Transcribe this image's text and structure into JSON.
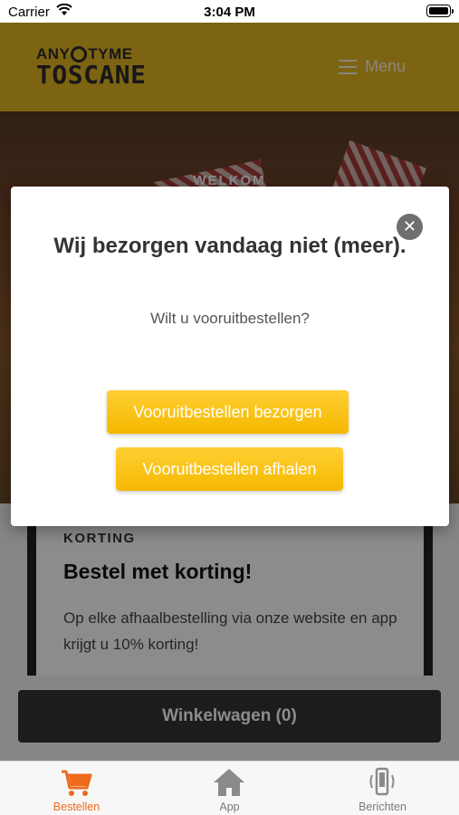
{
  "status_bar": {
    "carrier": "Carrier",
    "time": "3:04 PM"
  },
  "header": {
    "logo_line1_left": "ANY",
    "logo_line1_right": "TYME",
    "logo_line2": "TOSCANE",
    "menu_label": "Menu"
  },
  "hero": {
    "eyebrow": "WELKOM"
  },
  "card": {
    "eyebrow": "KORTING",
    "title": "Bestel met korting!",
    "body": "Op elke afhaalbestelling via onze website en app krijgt u 10% korting!"
  },
  "cart_button": {
    "label": "Winkelwagen (0)"
  },
  "modal": {
    "title": "Wij bezorgen vandaag niet (meer).",
    "subtitle": "Wilt u vooruitbestellen?",
    "button_delivery": "Vooruitbestellen bezorgen",
    "button_pickup": "Vooruitbestellen afhalen",
    "close_symbol": "✕"
  },
  "tabbar": {
    "tabs": [
      {
        "label": "Bestellen",
        "icon": "cart-icon",
        "active": true
      },
      {
        "label": "App",
        "icon": "home-icon",
        "active": false
      },
      {
        "label": "Berichten",
        "icon": "phone-vibrate-icon",
        "active": false
      }
    ]
  },
  "colors": {
    "header": "#e3b622",
    "accent_button": "#f5b800",
    "active_tab": "#ee6a1d",
    "cart_button": "#333333"
  }
}
